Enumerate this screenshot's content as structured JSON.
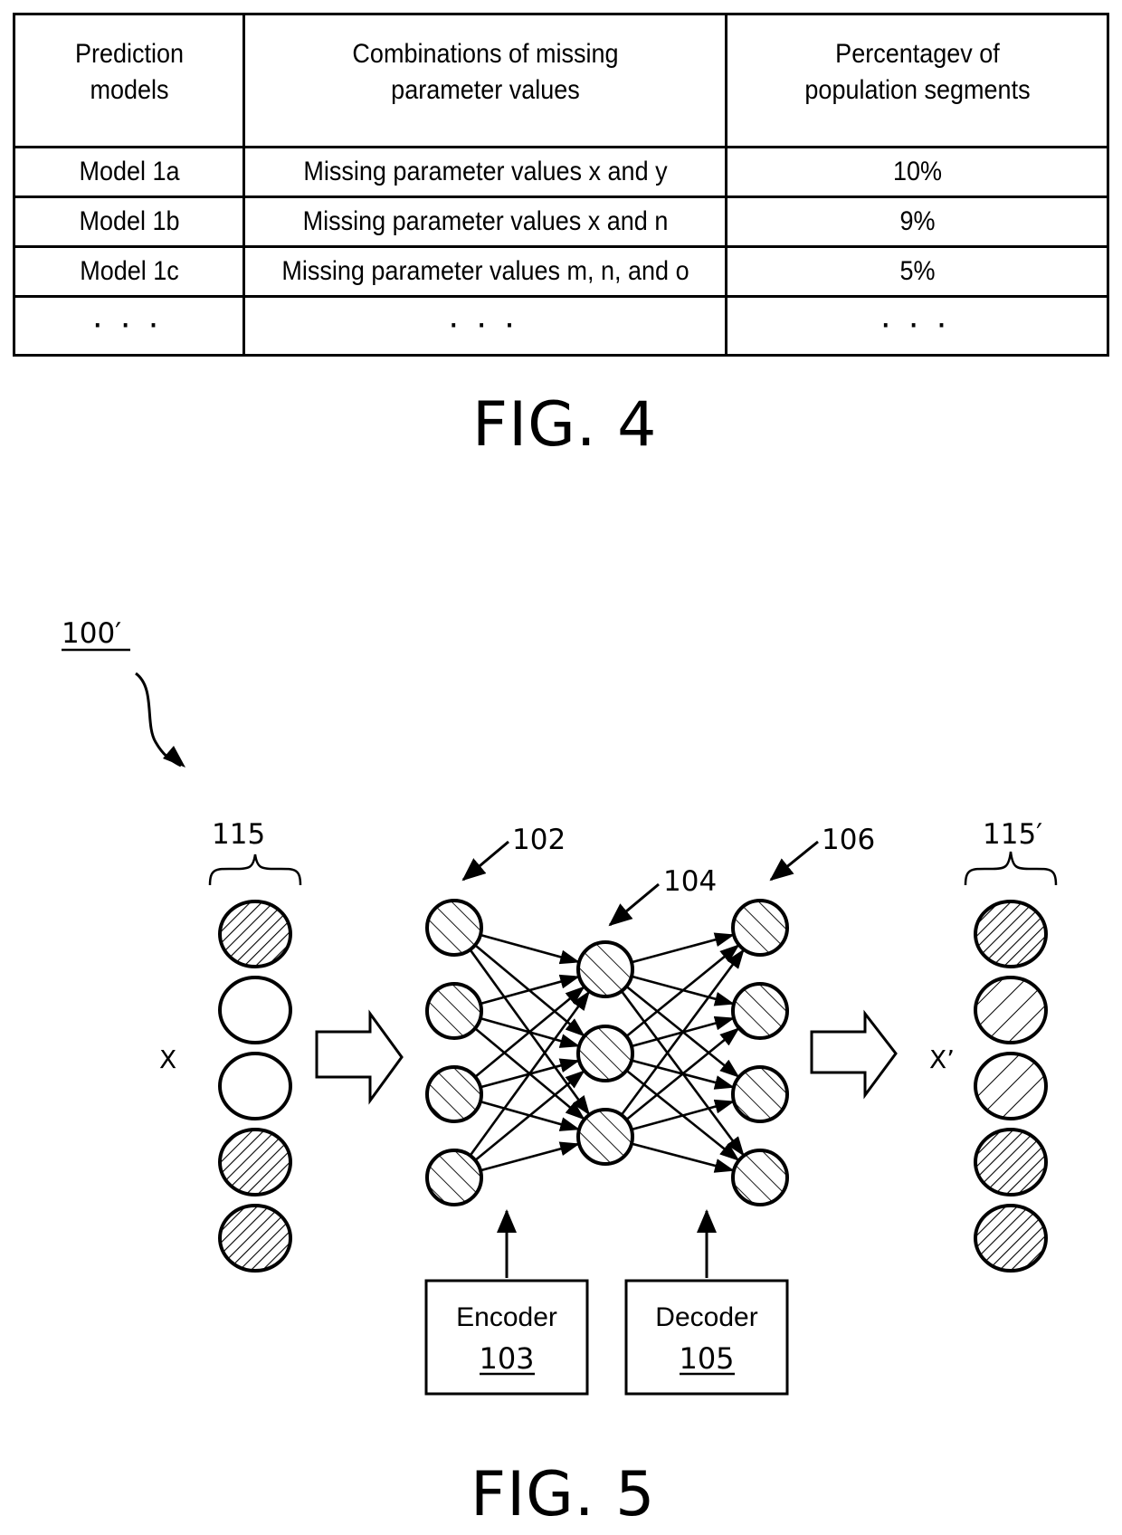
{
  "fig4": {
    "caption": "FIG. 4",
    "headers": [
      "Prediction\nmodels",
      "Combinations of missing\nparameter values",
      "Percentagev of\npopulation segments"
    ],
    "header_lines": [
      [
        "Prediction",
        "models"
      ],
      [
        "Combinations of missing",
        "parameter values"
      ],
      [
        "Percentagev of",
        "population segments"
      ]
    ],
    "rows": [
      [
        "Model 1a",
        "Missing parameter values x and y",
        "10%"
      ],
      [
        "Model 1b",
        "Missing parameter values x and n",
        "9%"
      ],
      [
        "Model 1c",
        "Missing parameter values m, n, and o",
        "5%"
      ],
      [
        "· · ·",
        "· · ·",
        "· · ·"
      ]
    ]
  },
  "fig5": {
    "caption": "FIG. 5",
    "system_ref": "100′",
    "input_ref": "115",
    "output_ref": "115′",
    "input_label": "X",
    "output_label": "X’",
    "layer_refs": {
      "input_layer": "102",
      "hidden_layer": "104",
      "output_layer": "106"
    },
    "encoder": {
      "label": "Encoder",
      "ref": "103"
    },
    "decoder": {
      "label": "Decoder",
      "ref": "105"
    },
    "input_nodes": [
      "filled",
      "missing",
      "missing",
      "filled",
      "filled"
    ],
    "output_nodes": [
      "filled",
      "imputed",
      "imputed",
      "filled",
      "filled"
    ],
    "layer_sizes": [
      4,
      3,
      4
    ]
  }
}
